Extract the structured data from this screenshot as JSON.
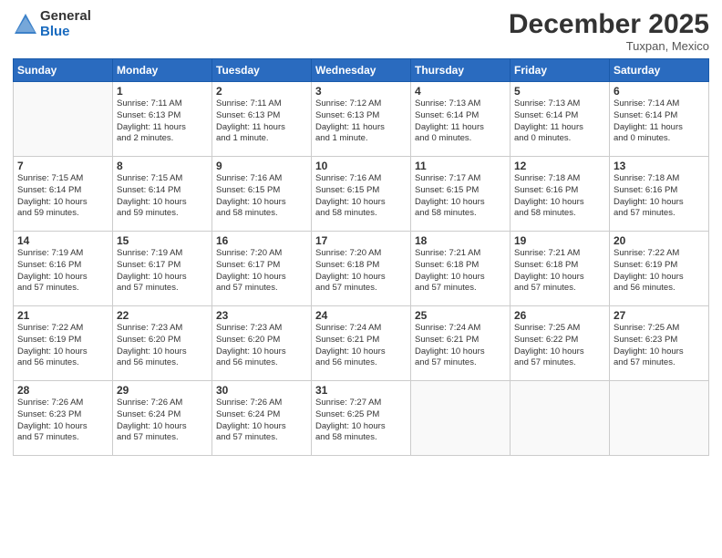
{
  "header": {
    "logo_general": "General",
    "logo_blue": "Blue",
    "month_title": "December 2025",
    "subtitle": "Tuxpan, Mexico"
  },
  "days_of_week": [
    "Sunday",
    "Monday",
    "Tuesday",
    "Wednesday",
    "Thursday",
    "Friday",
    "Saturday"
  ],
  "weeks": [
    [
      {
        "day": "",
        "info": ""
      },
      {
        "day": "1",
        "info": "Sunrise: 7:11 AM\nSunset: 6:13 PM\nDaylight: 11 hours\nand 2 minutes."
      },
      {
        "day": "2",
        "info": "Sunrise: 7:11 AM\nSunset: 6:13 PM\nDaylight: 11 hours\nand 1 minute."
      },
      {
        "day": "3",
        "info": "Sunrise: 7:12 AM\nSunset: 6:13 PM\nDaylight: 11 hours\nand 1 minute."
      },
      {
        "day": "4",
        "info": "Sunrise: 7:13 AM\nSunset: 6:14 PM\nDaylight: 11 hours\nand 0 minutes."
      },
      {
        "day": "5",
        "info": "Sunrise: 7:13 AM\nSunset: 6:14 PM\nDaylight: 11 hours\nand 0 minutes."
      },
      {
        "day": "6",
        "info": "Sunrise: 7:14 AM\nSunset: 6:14 PM\nDaylight: 11 hours\nand 0 minutes."
      }
    ],
    [
      {
        "day": "7",
        "info": "Sunrise: 7:15 AM\nSunset: 6:14 PM\nDaylight: 10 hours\nand 59 minutes."
      },
      {
        "day": "8",
        "info": "Sunrise: 7:15 AM\nSunset: 6:14 PM\nDaylight: 10 hours\nand 59 minutes."
      },
      {
        "day": "9",
        "info": "Sunrise: 7:16 AM\nSunset: 6:15 PM\nDaylight: 10 hours\nand 58 minutes."
      },
      {
        "day": "10",
        "info": "Sunrise: 7:16 AM\nSunset: 6:15 PM\nDaylight: 10 hours\nand 58 minutes."
      },
      {
        "day": "11",
        "info": "Sunrise: 7:17 AM\nSunset: 6:15 PM\nDaylight: 10 hours\nand 58 minutes."
      },
      {
        "day": "12",
        "info": "Sunrise: 7:18 AM\nSunset: 6:16 PM\nDaylight: 10 hours\nand 58 minutes."
      },
      {
        "day": "13",
        "info": "Sunrise: 7:18 AM\nSunset: 6:16 PM\nDaylight: 10 hours\nand 57 minutes."
      }
    ],
    [
      {
        "day": "14",
        "info": "Sunrise: 7:19 AM\nSunset: 6:16 PM\nDaylight: 10 hours\nand 57 minutes."
      },
      {
        "day": "15",
        "info": "Sunrise: 7:19 AM\nSunset: 6:17 PM\nDaylight: 10 hours\nand 57 minutes."
      },
      {
        "day": "16",
        "info": "Sunrise: 7:20 AM\nSunset: 6:17 PM\nDaylight: 10 hours\nand 57 minutes."
      },
      {
        "day": "17",
        "info": "Sunrise: 7:20 AM\nSunset: 6:18 PM\nDaylight: 10 hours\nand 57 minutes."
      },
      {
        "day": "18",
        "info": "Sunrise: 7:21 AM\nSunset: 6:18 PM\nDaylight: 10 hours\nand 57 minutes."
      },
      {
        "day": "19",
        "info": "Sunrise: 7:21 AM\nSunset: 6:18 PM\nDaylight: 10 hours\nand 57 minutes."
      },
      {
        "day": "20",
        "info": "Sunrise: 7:22 AM\nSunset: 6:19 PM\nDaylight: 10 hours\nand 56 minutes."
      }
    ],
    [
      {
        "day": "21",
        "info": "Sunrise: 7:22 AM\nSunset: 6:19 PM\nDaylight: 10 hours\nand 56 minutes."
      },
      {
        "day": "22",
        "info": "Sunrise: 7:23 AM\nSunset: 6:20 PM\nDaylight: 10 hours\nand 56 minutes."
      },
      {
        "day": "23",
        "info": "Sunrise: 7:23 AM\nSunset: 6:20 PM\nDaylight: 10 hours\nand 56 minutes."
      },
      {
        "day": "24",
        "info": "Sunrise: 7:24 AM\nSunset: 6:21 PM\nDaylight: 10 hours\nand 56 minutes."
      },
      {
        "day": "25",
        "info": "Sunrise: 7:24 AM\nSunset: 6:21 PM\nDaylight: 10 hours\nand 57 minutes."
      },
      {
        "day": "26",
        "info": "Sunrise: 7:25 AM\nSunset: 6:22 PM\nDaylight: 10 hours\nand 57 minutes."
      },
      {
        "day": "27",
        "info": "Sunrise: 7:25 AM\nSunset: 6:23 PM\nDaylight: 10 hours\nand 57 minutes."
      }
    ],
    [
      {
        "day": "28",
        "info": "Sunrise: 7:26 AM\nSunset: 6:23 PM\nDaylight: 10 hours\nand 57 minutes."
      },
      {
        "day": "29",
        "info": "Sunrise: 7:26 AM\nSunset: 6:24 PM\nDaylight: 10 hours\nand 57 minutes."
      },
      {
        "day": "30",
        "info": "Sunrise: 7:26 AM\nSunset: 6:24 PM\nDaylight: 10 hours\nand 57 minutes."
      },
      {
        "day": "31",
        "info": "Sunrise: 7:27 AM\nSunset: 6:25 PM\nDaylight: 10 hours\nand 58 minutes."
      },
      {
        "day": "",
        "info": ""
      },
      {
        "day": "",
        "info": ""
      },
      {
        "day": "",
        "info": ""
      }
    ]
  ]
}
